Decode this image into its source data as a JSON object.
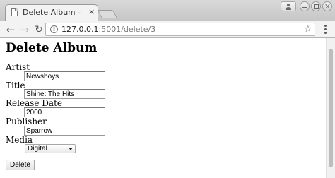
{
  "browser": {
    "tab": {
      "title": "Delete Album - Flask M",
      "close_glyph": "×"
    },
    "nav": {
      "back_glyph": "←",
      "forward_glyph": "→",
      "reload_glyph": "↻"
    },
    "omnibox": {
      "info_glyph": "i",
      "url_host": "127.0.0.1",
      "url_rest": ":5001/delete/3",
      "star_glyph": "☆"
    }
  },
  "page": {
    "title": "Delete Album",
    "form": {
      "artist_label": "Artist",
      "artist_value": "Newsboys",
      "title_label": "Title",
      "title_value": "Shine: The Hits",
      "release_date_label": "Release Date",
      "release_date_value": "2000",
      "publisher_label": "Publisher",
      "publisher_value": "Sparrow",
      "media_label": "Media",
      "media_value": "Digital",
      "submit_label": "Delete"
    }
  },
  "icons": {
    "tab_favicon": "page-icon",
    "profile": "person-icon",
    "info": "info-icon",
    "bookmark": "star-icon",
    "menu": "three-dots-icon",
    "select_arrow": "triangle-down-icon"
  }
}
